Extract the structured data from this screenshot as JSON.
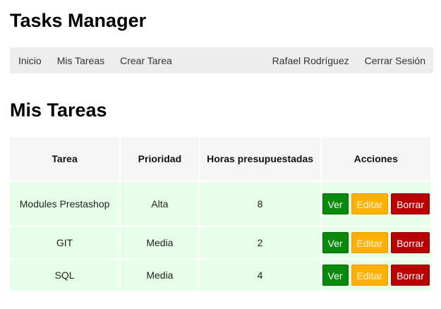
{
  "app": {
    "title": "Tasks Manager"
  },
  "navbar": {
    "left": [
      {
        "label": "Inicio"
      },
      {
        "label": "Mis Tareas"
      },
      {
        "label": "Crear Tarea"
      }
    ],
    "user_name": "Rafael Rodríguez",
    "logout_label": "Cerrar Sesión"
  },
  "page": {
    "heading": "Mis Tareas"
  },
  "table": {
    "headers": {
      "task": "Tarea",
      "priority": "Prioridad",
      "hours": "Horas presupuestadas",
      "actions": "Acciones"
    },
    "rows": [
      {
        "task": "Modules Prestashop",
        "priority": "Alta",
        "hours": "8"
      },
      {
        "task": "GIT",
        "priority": "Media",
        "hours": "2"
      },
      {
        "task": "SQL",
        "priority": "Media",
        "hours": "4"
      }
    ],
    "actions": {
      "view_label": "Ver",
      "edit_label": "Editar",
      "delete_label": "Borrar"
    }
  },
  "colors": {
    "view_button": "#0a8a0a",
    "edit_button": "#ffb000",
    "delete_button": "#b80000",
    "row_background": "#e6ffe8",
    "header_background": "#f5f5f5",
    "navbar_background": "#ededed"
  }
}
